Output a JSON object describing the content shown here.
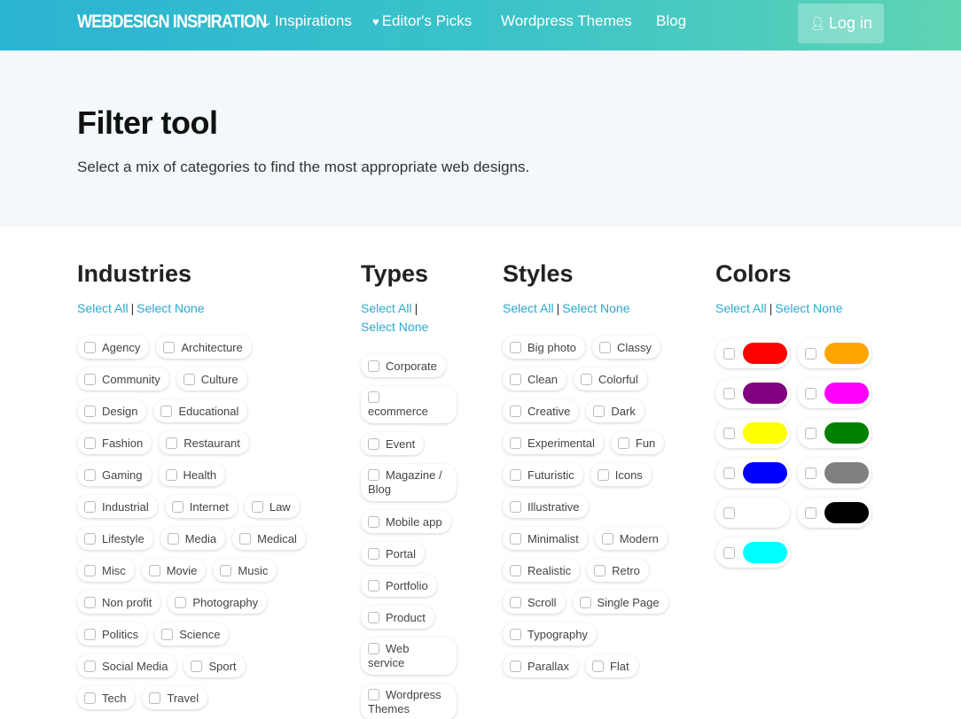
{
  "header": {
    "logo": "WEBDESIGN INSPIRATION",
    "nav": [
      "Inspirations",
      "Editor's Picks",
      "Wordpress Themes",
      "Blog"
    ],
    "login": "Log in"
  },
  "hero": {
    "title": "Filter tool",
    "subtitle": "Select a mix of categories to find the most appropriate web designs."
  },
  "select_all": "Select All",
  "select_none": "Select None",
  "industries": {
    "title": "Industries",
    "items": [
      "Agency",
      "Architecture",
      "Community",
      "Culture",
      "Design",
      "Educational",
      "Fashion",
      "Restaurant",
      "Gaming",
      "Health",
      "Industrial",
      "Internet",
      "Law",
      "Lifestyle",
      "Media",
      "Medical",
      "Misc",
      "Movie",
      "Music",
      "Non profit",
      "Photography",
      "Politics",
      "Science",
      "Social Media",
      "Sport",
      "Tech",
      "Travel"
    ]
  },
  "types": {
    "title": "Types",
    "items": [
      "Corporate",
      "ecommerce",
      "Event",
      "Magazine / Blog",
      "Mobile app",
      "Portal",
      "Portfolio",
      "Product",
      "Web service",
      "Wordpress Themes"
    ]
  },
  "styles": {
    "title": "Styles",
    "items": [
      "Big photo",
      "Classy",
      "Clean",
      "Colorful",
      "Creative",
      "Dark",
      "Experimental",
      "Fun",
      "Futuristic",
      "Icons",
      "Illustrative",
      "Minimalist",
      "Modern",
      "Realistic",
      "Retro",
      "Scroll",
      "Single Page",
      "Typography",
      "Parallax",
      "Flat"
    ]
  },
  "colors": {
    "title": "Colors",
    "swatches": [
      "#ff0000",
      "#ffa500",
      "#800080",
      "#ff00ff",
      "#ffff00",
      "#008000",
      "#0000ff",
      "#808080",
      "#ffffff",
      "#000000",
      "#00ffff"
    ]
  }
}
